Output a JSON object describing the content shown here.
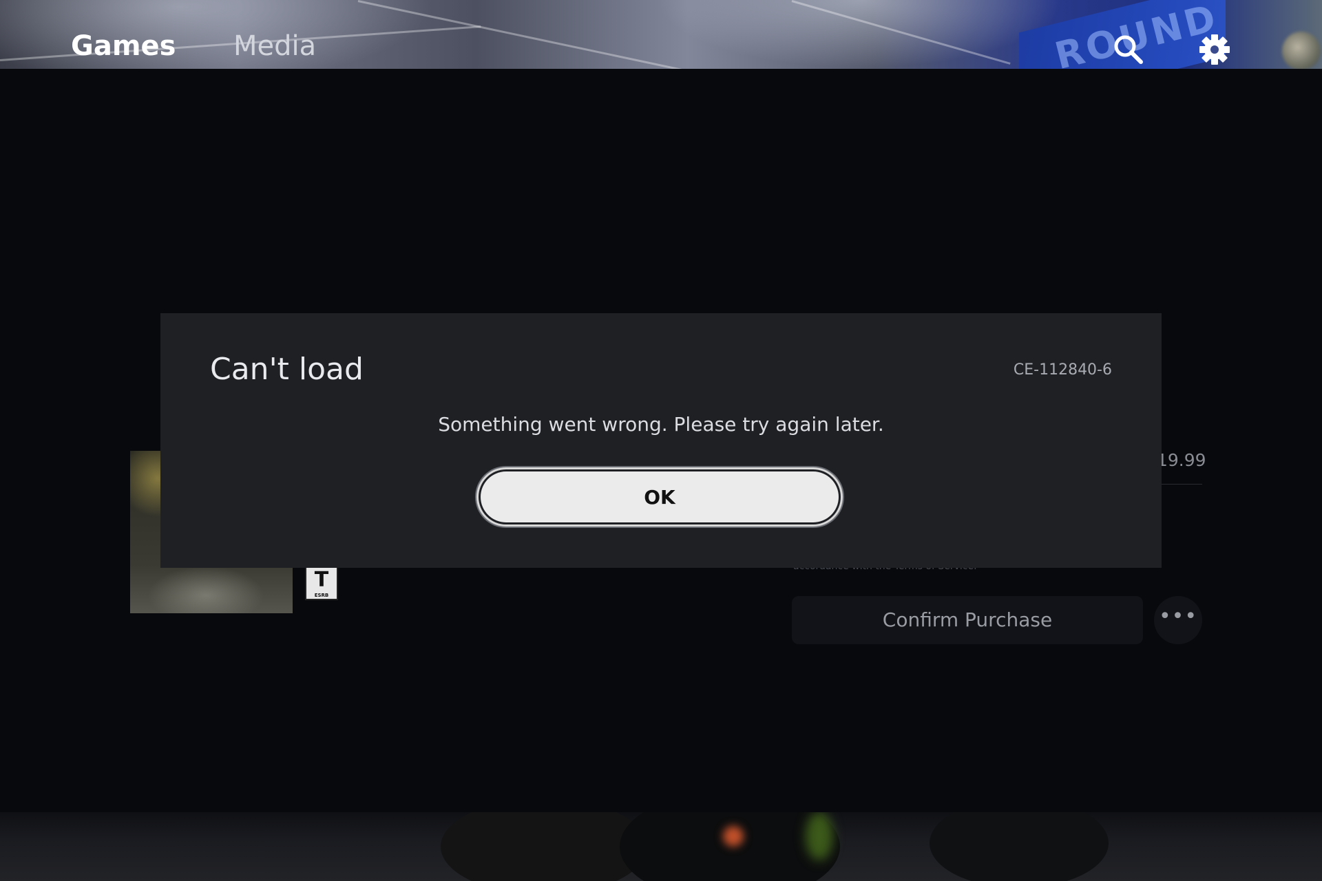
{
  "nav": {
    "tabs": [
      {
        "label": "Games",
        "active": true
      },
      {
        "label": "Media",
        "active": false
      }
    ],
    "icons": [
      "search-icon",
      "gear-icon"
    ]
  },
  "store_page": {
    "price": "19.99",
    "terms_text": "accordance with the Terms of Service.",
    "rating": {
      "letter": "T",
      "sub": "ESRB"
    },
    "confirm_label": "Confirm Purchase",
    "more_label": "•••"
  },
  "dialog": {
    "title": "Can't load",
    "error_code": "CE-112840-6",
    "message": "Something went wrong. Please try again later.",
    "ok_label": "OK"
  }
}
